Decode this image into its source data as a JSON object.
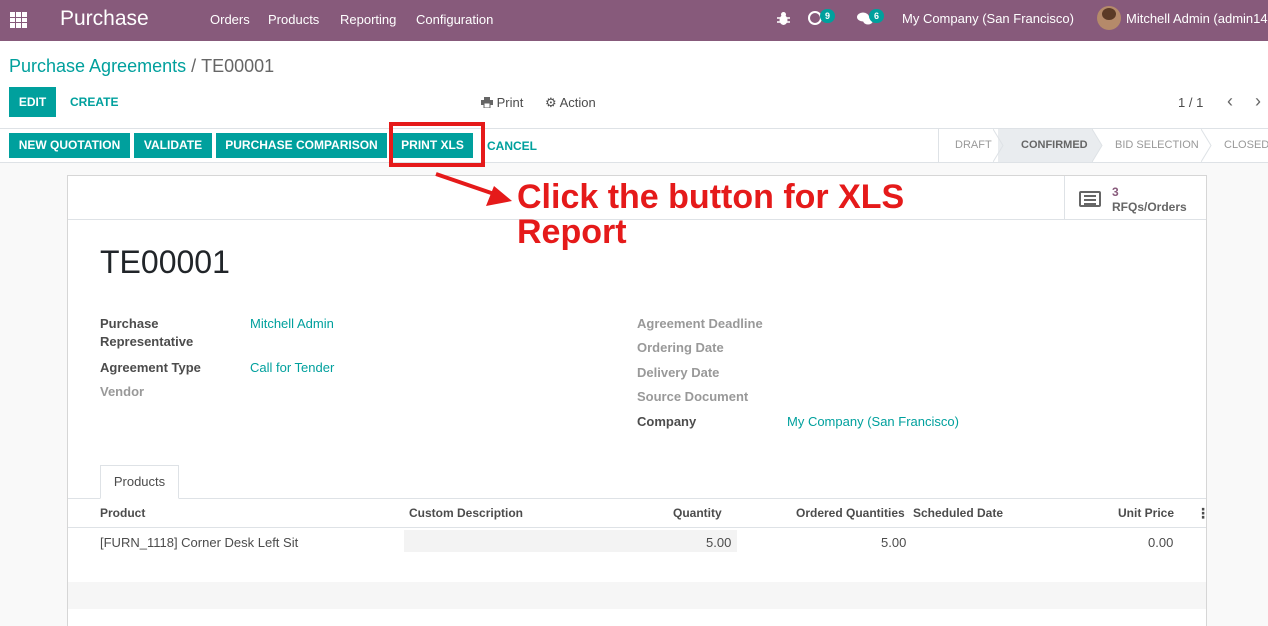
{
  "navbar": {
    "app_name": "Purchase",
    "menu": [
      "Orders",
      "Products",
      "Reporting",
      "Configuration"
    ],
    "activity_count": "9",
    "message_count": "6",
    "company": "My Company (San Francisco)",
    "user": "Mitchell Admin (admin14"
  },
  "breadcrumb": {
    "parent": "Purchase Agreements",
    "separator": "/",
    "current": "TE00001"
  },
  "control": {
    "edit_label": "EDIT",
    "create_label": "CREATE",
    "print_label": "Print",
    "action_label": "Action",
    "pager": "1 / 1"
  },
  "status_buttons": {
    "new_quotation": "NEW QUOTATION",
    "validate": "VALIDATE",
    "purchase_comparison": "PURCHASE COMPARISON",
    "print_xls": "PRINT XLS",
    "cancel": "CANCEL"
  },
  "stages": {
    "items": [
      "DRAFT",
      "CONFIRMED",
      "BID SELECTION",
      "CLOSED"
    ],
    "active": "CONFIRMED"
  },
  "smart_button": {
    "count": "3",
    "label": "RFQs/Orders"
  },
  "annotation": {
    "line1": "Click the button for XLS",
    "line2": "Report"
  },
  "form": {
    "title": "TE00001",
    "purchase_rep_label_1": "Purchase",
    "purchase_rep_label_2": "Representative",
    "purchase_rep_value": "Mitchell Admin",
    "agreement_type_label": "Agreement Type",
    "agreement_type_value": "Call for Tender",
    "vendor_label": "Vendor",
    "agreement_deadline_label": "Agreement Deadline",
    "ordering_date_label": "Ordering Date",
    "delivery_date_label": "Delivery Date",
    "source_document_label": "Source Document",
    "company_label": "Company",
    "company_value": "My Company (San Francisco)"
  },
  "products_tab": {
    "label": "Products",
    "columns": [
      "Product",
      "Custom Description",
      "Quantity",
      "Ordered Quantities",
      "Scheduled Date",
      "Unit Price"
    ],
    "rows": [
      {
        "product": "[FURN_1118] Corner Desk Left Sit",
        "custom_description": "",
        "quantity": "5.00",
        "ordered_quantities": "5.00",
        "scheduled_date": "",
        "unit_price": "0.00"
      }
    ]
  },
  "colors": {
    "navbar": "#875a7b",
    "primary": "#00a09d",
    "annotation": "#e51a1a"
  }
}
